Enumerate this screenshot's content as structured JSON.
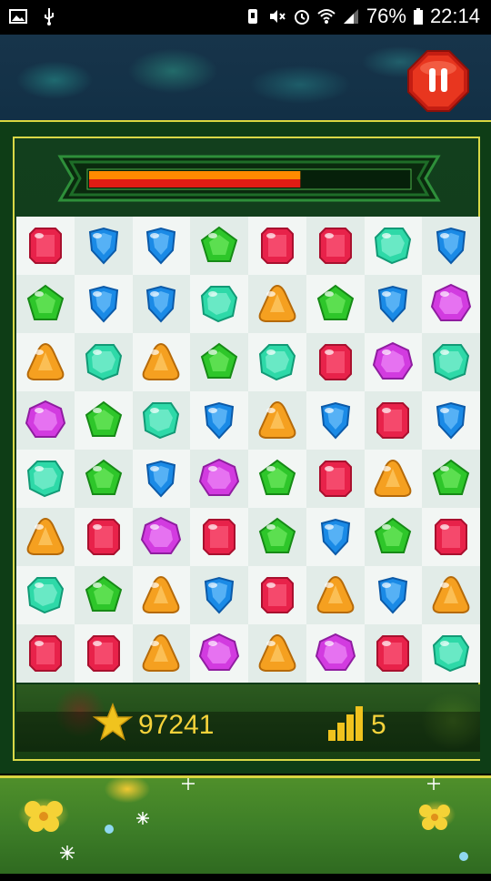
{
  "status_bar": {
    "battery": "76%",
    "time": "22:14",
    "left_icons": [
      "image-icon",
      "usb-icon"
    ],
    "right_icons": [
      "vibrate-icon",
      "mute-icon",
      "alarm-icon",
      "wifi-icon",
      "signal-icon",
      "battery-icon"
    ]
  },
  "game": {
    "progress_fraction": 0.66,
    "score": "97241",
    "level": "5",
    "colors": {
      "red": "#e8224a",
      "blue": "#1a8ae6",
      "green": "#2ec62a",
      "teal": "#2ed9a8",
      "orange": "#f5a020",
      "purple": "#d23be0",
      "accent": "#d9d847"
    },
    "board": [
      [
        "red",
        "blue",
        "blue",
        "green",
        "red",
        "red",
        "teal",
        "blue"
      ],
      [
        "green",
        "blue",
        "blue",
        "teal",
        "orange",
        "green",
        "blue",
        "purple"
      ],
      [
        "orange",
        "teal",
        "orange",
        "green",
        "teal",
        "red",
        "purple",
        "teal"
      ],
      [
        "purple",
        "green",
        "teal",
        "blue",
        "orange",
        "blue",
        "red",
        "blue"
      ],
      [
        "teal",
        "green",
        "blue",
        "purple",
        "green",
        "red",
        "orange",
        "green"
      ],
      [
        "orange",
        "red",
        "purple",
        "red",
        "green",
        "blue",
        "green",
        "red"
      ],
      [
        "teal",
        "green",
        "orange",
        "blue",
        "red",
        "orange",
        "blue",
        "orange"
      ],
      [
        "red",
        "red",
        "orange",
        "purple",
        "orange",
        "purple",
        "red",
        "teal"
      ]
    ]
  }
}
